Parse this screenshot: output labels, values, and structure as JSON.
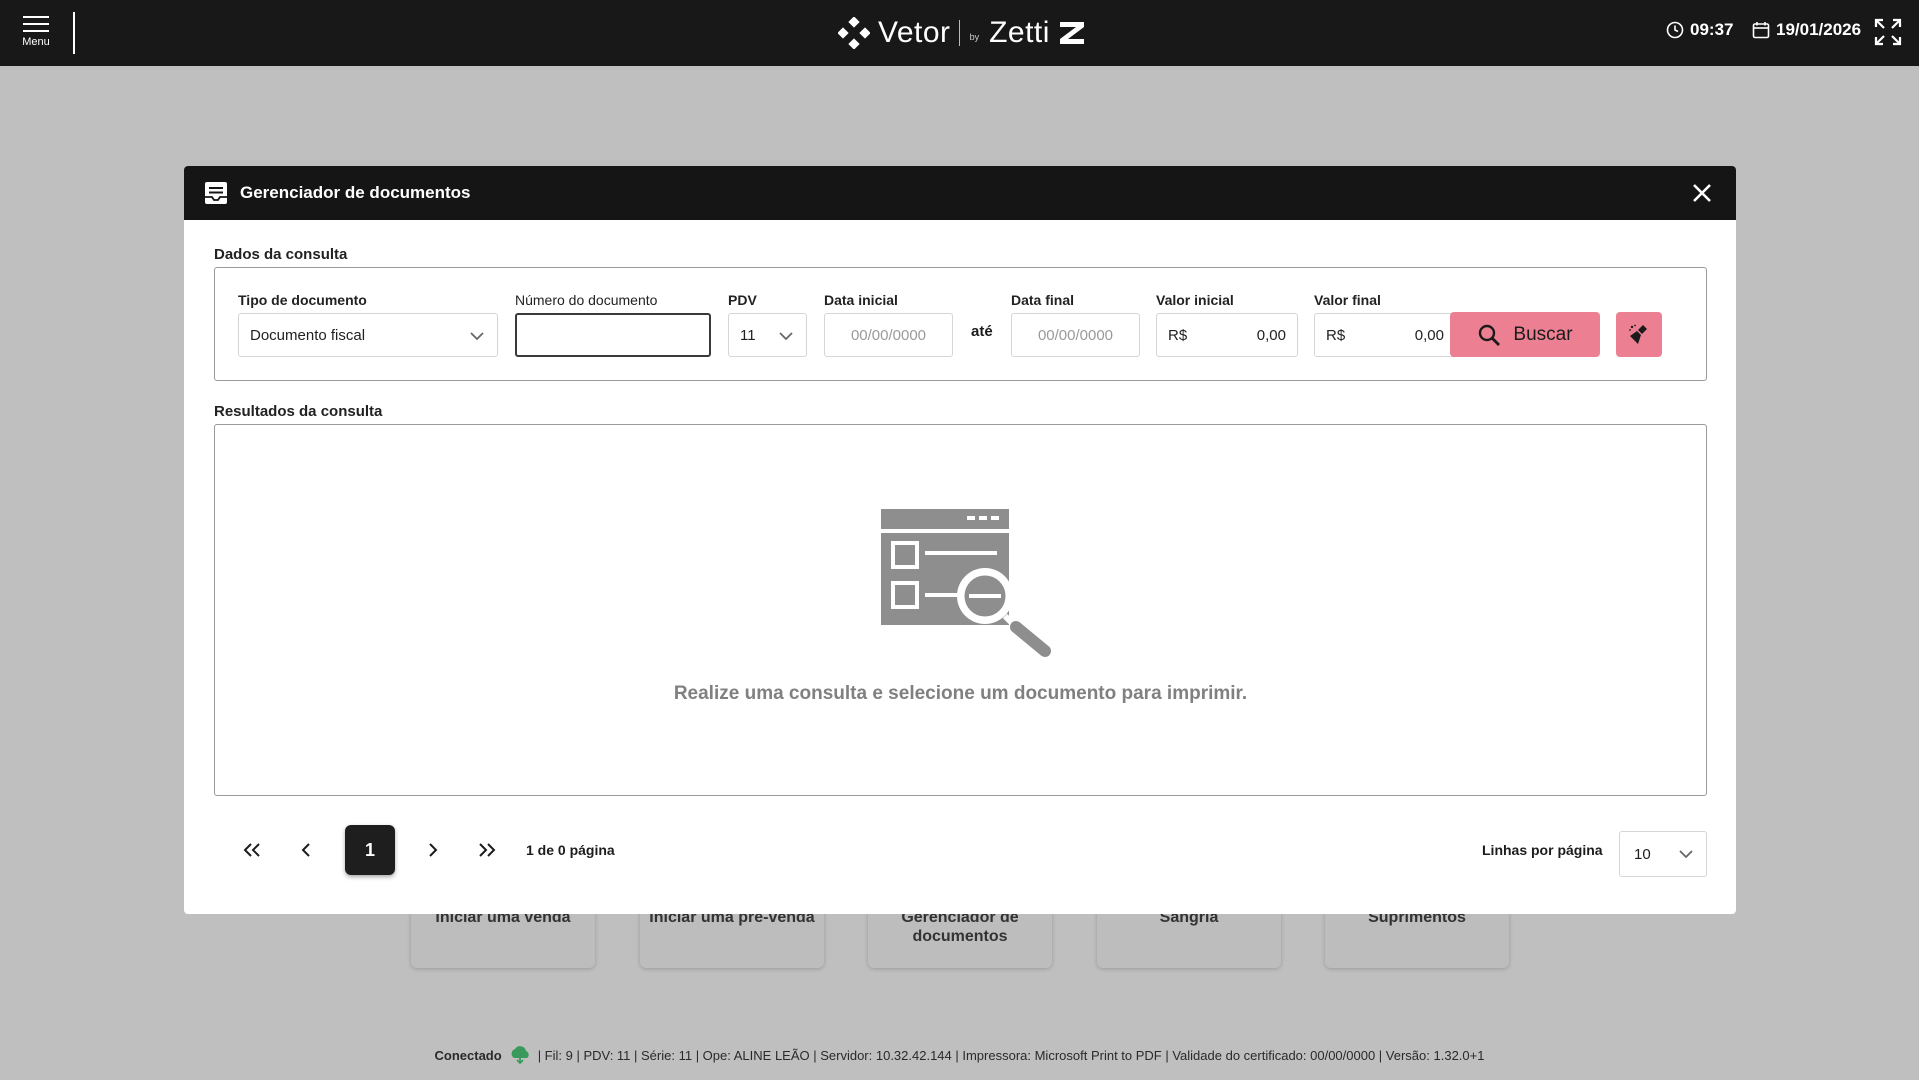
{
  "topbar": {
    "menu_label": "Menu",
    "brand_main": "Vetor",
    "brand_by": "by",
    "brand_secondary": "Zetti",
    "time": "09:37",
    "date": "19/01/2026"
  },
  "background_tiles": [
    {
      "label": "Iniciar uma venda"
    },
    {
      "label": "Iniciar uma pré-venda"
    },
    {
      "label": "Gerenciador de documentos"
    },
    {
      "label": "Sangria"
    },
    {
      "label": "Suprimentos"
    }
  ],
  "statusbar": {
    "connection": "Conectado",
    "details": "| Fil: 9 | PDV: 11 | Série: 11 | Ope: ALINE LEÃO | Servidor: 10.32.42.144 | Impressora: Microsoft Print to PDF | Validade do certificado: 00/00/0000 | Versão: 1.32.0+1"
  },
  "modal": {
    "title": "Gerenciador de documentos",
    "query_section": "Dados da consulta",
    "fields": {
      "tipo_label": "Tipo de documento",
      "tipo_value": "Documento fiscal",
      "numero_label": "Número do documento",
      "numero_value": "",
      "pdv_label": "PDV",
      "pdv_value": "11",
      "data_inicial_label": "Data inicial",
      "data_inicial_placeholder": "00/00/0000",
      "ate": "até",
      "data_final_label": "Data final",
      "data_final_placeholder": "00/00/0000",
      "valor_inicial_label": "Valor inicial",
      "valor_inicial_currency": "R$",
      "valor_inicial_value": "0,00",
      "valor_final_label": "Valor final",
      "valor_final_currency": "R$",
      "valor_final_value": "0,00"
    },
    "search_button": "Buscar",
    "results_section": "Resultados da consulta",
    "empty_message": "Realize uma consulta e selecione um documento para imprimir.",
    "pagination": {
      "current_page": "1",
      "info": "1 de 0 página",
      "rows_label": "Linhas por página",
      "rows_value": "10"
    }
  },
  "colors": {
    "accent": "#ed7f92",
    "header_bg": "#181818",
    "overlay": "#bfbfbf"
  }
}
